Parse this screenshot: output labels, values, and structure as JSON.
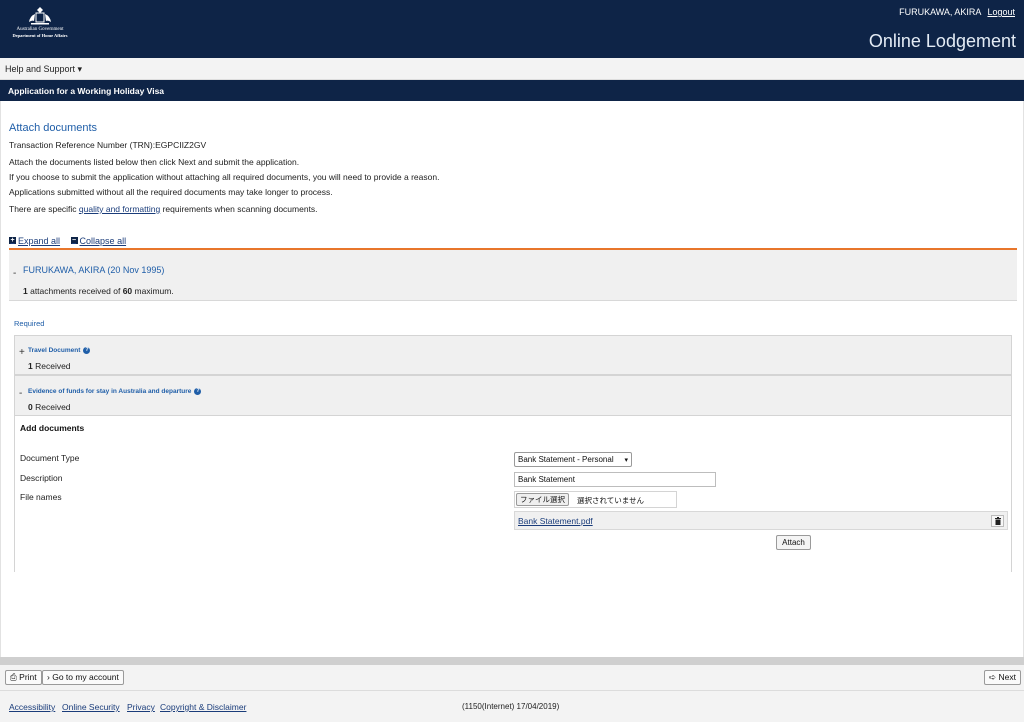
{
  "header": {
    "gov_line": "Australian Government",
    "dept_line": "Department of Home Affairs",
    "user_name": "FURUKAWA, AKIRA",
    "logout_label": "Logout",
    "app_title": "Online Lodgement",
    "brand_color": "#0e2447"
  },
  "help_menu": {
    "label": "Help and Support ▾"
  },
  "page_title": "Application for a Working Holiday Visa",
  "intro": {
    "heading": "Attach documents",
    "trn": "Transaction Reference Number (TRN):EGPCIIZ2GV",
    "line1": "Attach the documents listed below then click Next and submit the application.",
    "line2": "If you choose to submit the application without attaching all required documents, you will need to provide a reason.",
    "line3": "Applications submitted without all the required documents may take longer to process.",
    "line4_pre": "There are specific ",
    "line4_link": "quality and formatting",
    "line4_post": " requirements when scanning documents."
  },
  "expander": {
    "expand_all": "Expand all",
    "collapse_all": "Collapse all"
  },
  "applicant": {
    "toggle": "-",
    "name": "FURUKAWA, AKIRA (20 Nov 1995)",
    "received": "1",
    "count_mid": " attachments received of ",
    "max": "60",
    "count_end": " maximum."
  },
  "required_label": "Required",
  "documents": [
    {
      "toggle": "+",
      "label": "Travel Document",
      "received": "1",
      "received_label": " Received"
    },
    {
      "toggle": "-",
      "label": "Evidence of funds for stay in Australia and departure",
      "received": "0",
      "received_label": " Received"
    }
  ],
  "add_documents": {
    "title": "Add documents",
    "type_label": "Document Type",
    "type_value": "Bank Statement - Personal",
    "description_label": "Description",
    "description_value": "Bank Statement",
    "files_label": "File names",
    "file_button": "ファイル選択",
    "file_none": "選択されていません",
    "attached_file": "Bank Statement.pdf",
    "attach_button": "Attach",
    "trash_icon": "trash-icon"
  },
  "footer": {
    "print": "Print",
    "account": "Go to my account",
    "next": "Next",
    "links": [
      "Accessibility",
      "Online Security",
      "Privacy",
      "Copyright & Disclaimer"
    ],
    "version": "(1150(Internet) 17/04/2019)"
  },
  "accent_color": "#e8762b"
}
